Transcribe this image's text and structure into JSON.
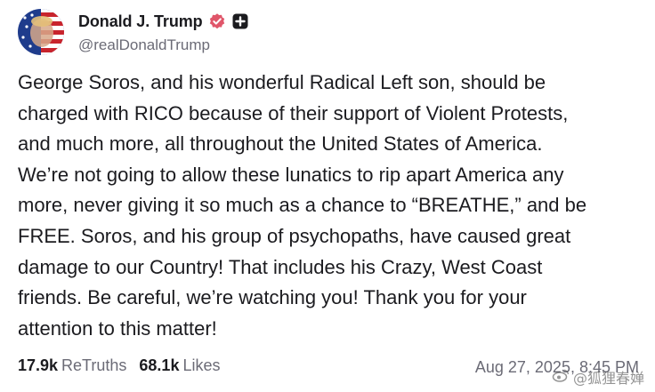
{
  "author": {
    "display_name": "Donald J. Trump",
    "handle": "@realDonaldTrump",
    "verified_icon": "verified-badge-icon",
    "plus_icon": "plus-badge-icon"
  },
  "post": {
    "text": "George Soros, and his wonderful Radical Left son, should be\ncharged with RICO because of their support of Violent Protests,\nand much more, all throughout the United States of America.\nWe’re not going to allow these lunatics to rip apart America any\nmore, never giving it so much as a chance to “BREATHE,” and be\nFREE. Soros, and his group of psychopaths, have caused great\ndamage to our Country! That includes his Crazy, West Coast\nfriends. Be careful, we’re watching you! Thank you for your\nattention to this matter!"
  },
  "stats": {
    "retruths_count": "17.9k",
    "retruths_label": "ReTruths",
    "likes_count": "68.1k",
    "likes_label": "Likes"
  },
  "timestamp": "Aug 27, 2025, 8:45 PM",
  "watermark": {
    "text": "@狐狸春婵",
    "icon": "weibo-icon"
  },
  "colors": {
    "text_primary": "#1b1b1f",
    "text_secondary": "#6b6b76",
    "verified_badge": "#e0566a",
    "plus_badge": "#1b1b1f"
  }
}
